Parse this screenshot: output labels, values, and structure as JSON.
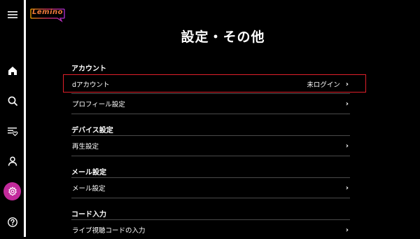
{
  "app": {
    "logo_text": "Lemino"
  },
  "sidebar": {
    "items": [
      {
        "name": "menu",
        "icon": "hamburger-menu-icon"
      },
      {
        "name": "home",
        "icon": "home-icon"
      },
      {
        "name": "search",
        "icon": "search-icon"
      },
      {
        "name": "watchlist",
        "icon": "list-heart-icon"
      },
      {
        "name": "profile",
        "icon": "user-icon"
      },
      {
        "name": "settings",
        "icon": "gear-icon",
        "active": true
      },
      {
        "name": "help",
        "icon": "help-icon"
      }
    ],
    "active_color": "#c22a9b"
  },
  "page": {
    "title": "設定・その他"
  },
  "sections": {
    "account": {
      "heading": "アカウント",
      "rows": [
        {
          "label": "dアカウント",
          "status": "未ログイン"
        },
        {
          "label": "プロフィール設定"
        }
      ]
    },
    "device": {
      "heading": "デバイス設定",
      "rows": [
        {
          "label": "再生設定"
        }
      ]
    },
    "mail": {
      "heading": "メール設定",
      "rows": [
        {
          "label": "メール設定"
        }
      ]
    },
    "code": {
      "heading": "コード入力",
      "rows": [
        {
          "label": "ライブ視聴コードの入力"
        }
      ]
    }
  },
  "chevron": "›",
  "colors": {
    "background": "#000000",
    "highlight_border": "#e0202a",
    "divider": "#4a4a4a"
  }
}
